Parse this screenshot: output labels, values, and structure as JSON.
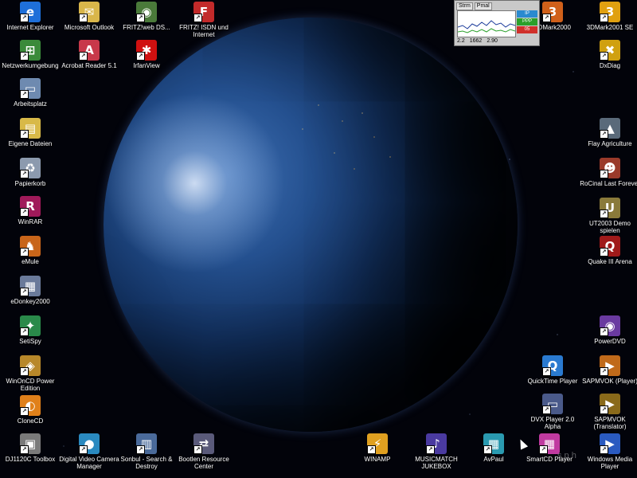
{
  "desktop": {
    "icons": [
      {
        "label": "Internet Explorer",
        "glyph": "e",
        "color": "#1e6fd9",
        "icon": "internet-explorer-icon"
      },
      {
        "label": "Microsoft Outlook",
        "glyph": "✉",
        "color": "#d9b64a",
        "icon": "outlook-icon"
      },
      {
        "label": "FRITZ!web DS...",
        "glyph": "◉",
        "color": "#4a7a3a",
        "icon": "fritz-web-icon"
      },
      {
        "label": "FRITZ! ISDN und Internet",
        "glyph": "F",
        "color": "#c22a2a",
        "icon": "fritz-isdn-icon"
      },
      {
        "label": "Netzwerkumgebung",
        "glyph": "⊞",
        "color": "#3a8a3a",
        "icon": "network-icon"
      },
      {
        "label": "Acrobat Reader 5.1",
        "glyph": "A",
        "color": "#c8384a",
        "icon": "acrobat-reader-icon"
      },
      {
        "label": "IrfanView",
        "glyph": "✱",
        "color": "#d01010",
        "icon": "irfanview-icon"
      },
      {
        "label": "Arbeitsplatz",
        "glyph": "▭",
        "color": "#6e8ab0",
        "icon": "my-computer-icon"
      },
      {
        "label": "Eigene Dateien",
        "glyph": "▤",
        "color": "#d8b948",
        "icon": "my-documents-icon"
      },
      {
        "label": "Papierkorb",
        "glyph": "♻",
        "color": "#8c9aae",
        "icon": "recycle-bin-icon"
      },
      {
        "label": "WinRAR",
        "glyph": "R",
        "color": "#a01a5a",
        "icon": "winrar-icon"
      },
      {
        "label": "eMule",
        "glyph": "♞",
        "color": "#c8651a",
        "icon": "emule-icon"
      },
      {
        "label": "eDonkey2000",
        "glyph": "▦",
        "color": "#6a7a9a",
        "icon": "edonkey-icon"
      },
      {
        "label": "SetiSpy",
        "glyph": "✦",
        "color": "#2a8a4a",
        "icon": "setispy-icon"
      },
      {
        "label": "WinOnCD Power Edition",
        "glyph": "◈",
        "color": "#b8882a",
        "icon": "winoncd-icon"
      },
      {
        "label": "CloneCD",
        "glyph": "◐",
        "color": "#e0801a",
        "icon": "clonecd-icon"
      },
      {
        "label": "DJ1120C Toolbox",
        "glyph": "▣",
        "color": "#7a7a7a",
        "icon": "printer-toolbox-icon"
      },
      {
        "label": "Digital Video Camera Manager",
        "glyph": "●",
        "color": "#2a8ac0",
        "icon": "video-camera-icon"
      },
      {
        "label": "Sonbul - Search & Destroy",
        "glyph": "▥",
        "color": "#4a6a9a",
        "icon": "search-destroy-icon"
      },
      {
        "label": "Bootlen Resource Center",
        "glyph": "⇄",
        "color": "#5a5a7a",
        "icon": "resource-center-icon"
      },
      {
        "label": "WINAMP",
        "glyph": "⚡",
        "color": "#e0a020",
        "icon": "winamp-icon"
      },
      {
        "label": "MUSICMATCH JUKEBOX",
        "glyph": "♪",
        "color": "#4a3aa0",
        "icon": "musicmatch-icon"
      },
      {
        "label": "AvPaul",
        "glyph": "▦",
        "color": "#2a9ab0",
        "icon": "avpaul-icon"
      },
      {
        "label": "SmartCD Player",
        "glyph": "▦",
        "color": "#c03aa0",
        "icon": "cd-player-icon"
      },
      {
        "label": "Windows Media Player",
        "glyph": "▶",
        "color": "#2a5ac0",
        "icon": "media-player-icon"
      },
      {
        "label": "3DMark2000",
        "glyph": "3",
        "color": "#d0601a",
        "icon": "3dmark2000-icon"
      },
      {
        "label": "3DMark2001 SE",
        "glyph": "3",
        "color": "#e0a010",
        "icon": "3dmark2001-icon"
      },
      {
        "label": "DxDiag",
        "glyph": "✖",
        "color": "#d0a010",
        "icon": "dxdiag-icon"
      },
      {
        "label": "Flay Agriculture",
        "glyph": "▲",
        "color": "#5a6a7a",
        "icon": "flay-icon"
      },
      {
        "label": "RoCinal Last Forever",
        "glyph": "☻",
        "color": "#9a3a2a",
        "icon": "game-nolf-icon"
      },
      {
        "label": "UT2003 Demo spielen",
        "glyph": "U",
        "color": "#8a7a3a",
        "icon": "ut2003-icon"
      },
      {
        "label": "Quake III Arena",
        "glyph": "Q",
        "color": "#a01a1a",
        "icon": "quake3-icon"
      },
      {
        "label": "PowerDVD",
        "glyph": "◉",
        "color": "#6a3aa0",
        "icon": "powerdvd-icon"
      },
      {
        "label": "QuickTime Player",
        "glyph": "Q",
        "color": "#2a7ad0",
        "icon": "quicktime-icon"
      },
      {
        "label": "SAPMVOK (Player)",
        "glyph": "▶",
        "color": "#c06a1a",
        "icon": "sapmvok-player-icon"
      },
      {
        "label": "DVX Player 2.0 Alpha",
        "glyph": "▭",
        "color": "#4a5a8a",
        "icon": "dvx-player-icon"
      },
      {
        "label": "SAPMVOK (Translator)",
        "glyph": "▶",
        "color": "#8a6a1a",
        "icon": "sapmvok-translator-icon"
      }
    ]
  },
  "meter": {
    "tab1": "Strm",
    "tab2": "Pmal",
    "ind1": "IP",
    "ind2": "PPP",
    "ind3": "05",
    "read1": "2.2",
    "read2": "1662",
    "read3": "2.90"
  },
  "watermark": "s p h"
}
